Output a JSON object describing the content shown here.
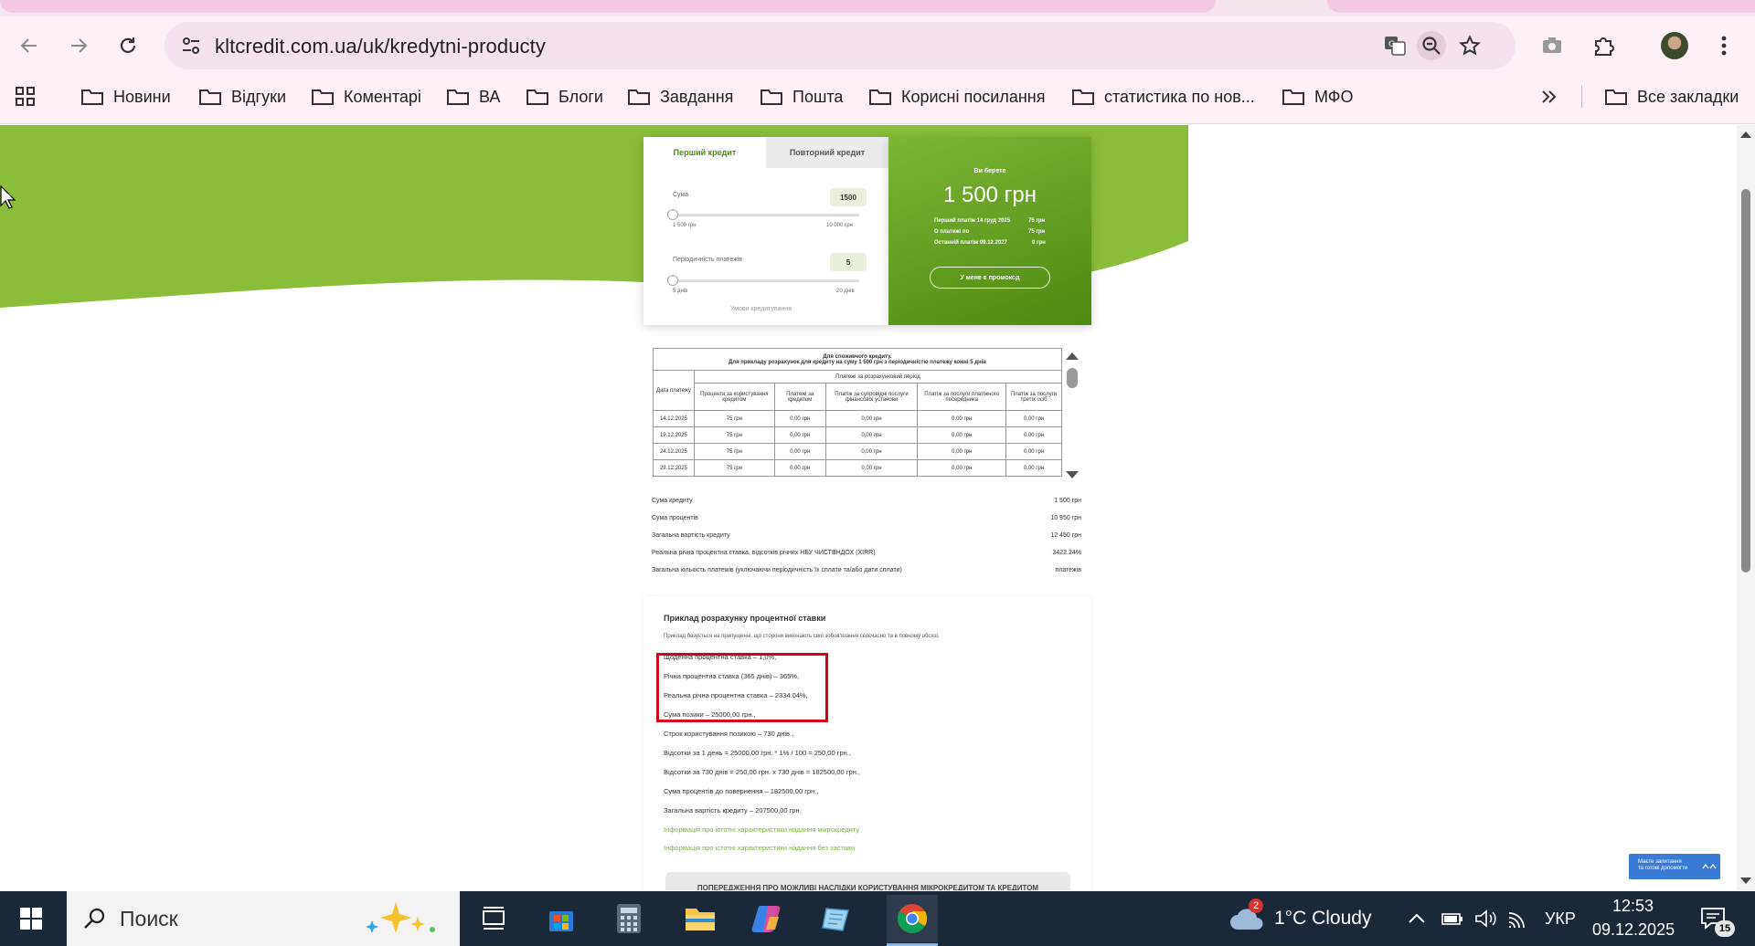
{
  "browser": {
    "url": "kltcredit.com.ua/uk/kredytni-producty",
    "bookmarks": [
      "Новини",
      "Відгуки",
      "Коментарі",
      "ВА",
      "Блоги",
      "Завдання",
      "Пошта",
      "Корисні посилання",
      "статистика по нов...",
      "МФО"
    ],
    "all_bookmarks": "Все закладки"
  },
  "calculator": {
    "tabs": [
      "Перший кредит",
      "Повторний кредит"
    ],
    "sum_label": "Сума",
    "sum_value": "1500",
    "sum_min": "1 500 грн",
    "sum_max": "10 000 грн",
    "period_label": "Періодичність платежів",
    "period_value": "5",
    "period_min": "5 днів",
    "period_max": "20 днів",
    "terms_link": "Умови кредитування",
    "you_take_label": "Ви берете",
    "you_take_amount": "1 500 грн",
    "rows": [
      {
        "label": "Перший платіж  14 груд 2025",
        "value": "75 грн"
      },
      {
        "label": "О платежі по",
        "value": "75 грн"
      },
      {
        "label": "Останній платіж 09.12.2027",
        "value": "0 грн"
      }
    ],
    "promo_button": "У мене є промокод"
  },
  "schedule": {
    "title": "Для споживчого кредиту.",
    "subtitle": "Для прикладу розрахунок для кредиту на суму 1 500 грн з періодичністю платежу кожні 5 днів",
    "group_header": "Платежі за розрахунковий період",
    "col_date": "Дата платежу",
    "cols": [
      "Проценти за користування кредитом",
      "Платежі за кредитом",
      "Платіж за супровідні послуги фінансової установи",
      "Платіж за послуги платіжного посередника",
      "Платіж за послуги третіх осіб"
    ],
    "rows": [
      [
        "14.12.2025",
        "75 грн",
        "0,00 грн",
        "0,00 грн",
        "0,00 грн",
        "0,00 грн"
      ],
      [
        "19.12.2025",
        "75 грн",
        "0,00 грн",
        "0,00 грн",
        "0,00 грн",
        "0,00 грн"
      ],
      [
        "24.12.2025",
        "75 грн",
        "0,00 грн",
        "0,00 грн",
        "0,00 грн",
        "0,00 грн"
      ],
      [
        "29.12.2025",
        "75 грн",
        "0,00 грн",
        "0,00 грн",
        "0,00 грн",
        "0,00 грн"
      ]
    ]
  },
  "summary": [
    {
      "label": "Сума кредиту",
      "value": "1 500 грн"
    },
    {
      "label": "Сума процентів",
      "value": "10 950 грн"
    },
    {
      "label": "Загальна вартість кредиту",
      "value": "12 450 грн"
    },
    {
      "label": "Реальна річна процентна ставка, відсотків річних НБУ ЧИСТВНДОХ (XIRR)",
      "value": "3422.24%"
    },
    {
      "label": "Загальна кількість платежів (уключаючи періодичність їх сплати та/або дати сплати)",
      "value": "платежів"
    }
  ],
  "example": {
    "title": "Приклад розрахунку процентної ставки",
    "intro": "Приклад базується на припущенні, що сторони виконають свої зобов'язання своєчасно та в повному обсязі.",
    "lines": [
      "Щоденна процентна ставка – 1,0%,",
      "Річна процентна ставка (365 днів) – 365%,",
      "Реальна річна процентна ставка – 2334.04%,",
      "Сума позики – 25000,00 грн.,",
      "Строк користування позикою – 730 днів.,",
      "Відсотки за 1 день = 25000,00 грн. * 1% / 100 = 250,00 грн.,",
      "Відсотки за 730 днів = 250,00 грн. x 730 днів = 182500,00 грн.,",
      "Сума процентів до повернення – 182500,00 грн.,",
      "Загальна вартість кредиту – 207500,00 грн."
    ],
    "links": [
      "Інформація про істотні характеристики надання мікрокредиту",
      "Інформація про істотні характеристики надання без застави"
    ],
    "warning": "ПОПЕРЕДЖЕННЯ ПРО МОЖЛИВІ НАСЛІДКИ КОРИСТУВАННЯ МІКРОКРЕДИТОМ ТА КРЕДИТОМ"
  },
  "chat_widget": {
    "line1": "Маєте запитання",
    "line2": "та готові допомогти"
  },
  "taskbar": {
    "search_placeholder": "Поиск",
    "weather_badge": "2",
    "weather": "1°C  Cloudy",
    "lang": "УКР",
    "time": "12:53",
    "date": "09.12.2025",
    "notif_count": "15"
  },
  "colors": {
    "brand_green": "#8bbd3a",
    "dark_green": "#4d8a12",
    "highlight_red": "#d0021b"
  }
}
